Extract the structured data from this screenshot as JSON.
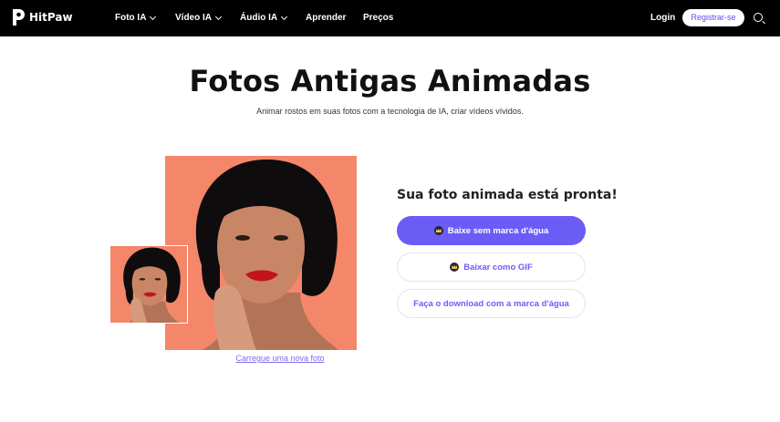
{
  "header": {
    "brand": "HitPaw",
    "nav": [
      {
        "label": "Foto IA",
        "has_dropdown": true
      },
      {
        "label": "Vídeo IA",
        "has_dropdown": true
      },
      {
        "label": "Áudio IA",
        "has_dropdown": true
      },
      {
        "label": "Aprender",
        "has_dropdown": false
      },
      {
        "label": "Preços",
        "has_dropdown": false
      }
    ],
    "login": "Login",
    "register": "Registrar-se",
    "search_icon": "search-icon"
  },
  "hero": {
    "title": "Fotos Antigas Animadas",
    "subtitle": "Animar rostos em suas fotos com a tecnologia de IA, criar vídeos vívidos."
  },
  "preview": {
    "upload_link": "Carregue uma nova foto"
  },
  "result": {
    "heading": "Sua foto animada está pronta!",
    "download_no_watermark": "Baixe sem marca d'água",
    "download_gif": "Baixar como GIF",
    "download_with_watermark": "Faça o download com a marca d'água"
  },
  "colors": {
    "accent": "#6c5cf6",
    "photo_background": "#f4866a",
    "navbar": "#000000"
  }
}
